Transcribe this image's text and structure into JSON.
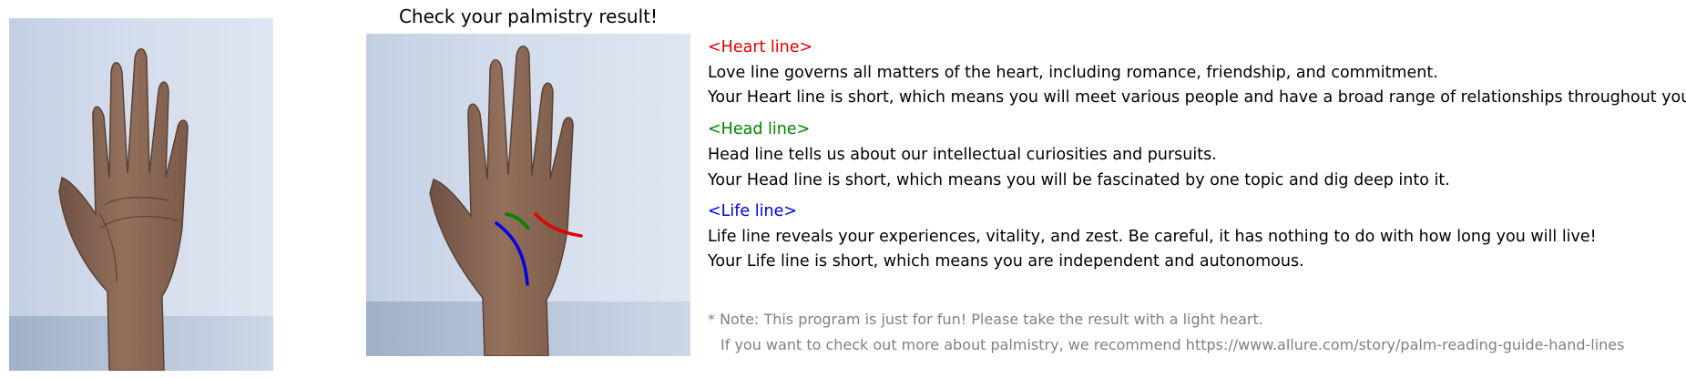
{
  "title": "Check your palmistry result!",
  "colors": {
    "heart": "#e00000",
    "head": "#008000",
    "life": "#0000e0",
    "note": "#808080"
  },
  "sections": {
    "heart": {
      "heading": "<Heart line>",
      "description": "Love line governs all matters of the heart, including romance, friendship, and commitment.",
      "result": "Your Heart line is short, which means you will meet various people and have a broad range of relationships throughout your life."
    },
    "head": {
      "heading": "<Head line>",
      "description": "Head line tells us about our intellectual curiosities and pursuits.",
      "result": "Your Head line is short, which means you will be fascinated by one topic and dig deep into it."
    },
    "life": {
      "heading": "<Life line>",
      "description": "Life line reveals your experiences, vitality, and zest. Be careful, it has nothing to do with how long you will live!",
      "result": "Your Life line is short, which means you are independent and autonomous."
    }
  },
  "note": {
    "line1": "* Note: This program is just for fun! Please take the result with a light heart.",
    "line2": "If you want to check out more about palmistry, we recommend https://www.allure.com/story/palm-reading-guide-hand-lines"
  }
}
